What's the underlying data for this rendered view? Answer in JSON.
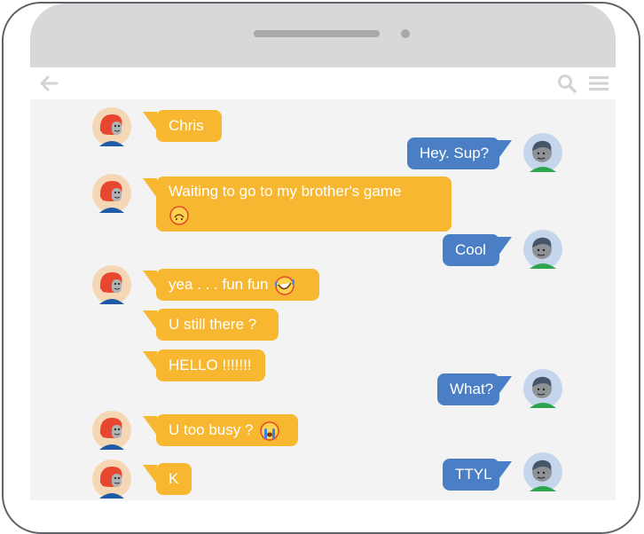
{
  "app": {
    "nav": {
      "back": "back-arrow-icon",
      "search": "search-icon",
      "menu": "hamburger-menu-icon"
    }
  },
  "colors": {
    "incoming_bubble": "#f7b731",
    "outgoing_bubble": "#4a7fc6",
    "chat_background": "#f3f3f3",
    "bezel": "#d7d8d9"
  },
  "messages": [
    {
      "sender": "friend",
      "text": "Chris"
    },
    {
      "sender": "me",
      "text": "Hey. Sup?"
    },
    {
      "sender": "friend",
      "text": "Waiting to go to my brother's game",
      "emoji": "upside-down-face-emoji"
    },
    {
      "sender": "me",
      "text": "Cool"
    },
    {
      "sender": "friend",
      "text": "yea . . . fun fun",
      "emoji": "rolling-laughing-emoji"
    },
    {
      "sender": "friend",
      "text": "U still there ?"
    },
    {
      "sender": "friend",
      "text": "HELLO !!!!!!!"
    },
    {
      "sender": "me",
      "text": "What?"
    },
    {
      "sender": "friend",
      "text": "U too busy ?",
      "emoji": "crying-face-emoji"
    },
    {
      "sender": "friend",
      "text": "K"
    },
    {
      "sender": "me",
      "text": "TTYL"
    }
  ]
}
